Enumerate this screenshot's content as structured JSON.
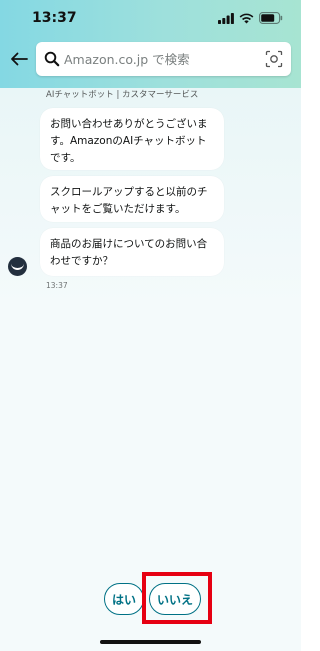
{
  "status_bar": {
    "time": "13:37",
    "icons": [
      "signal-icon",
      "wifi-icon",
      "battery-icon"
    ]
  },
  "header": {
    "back_icon": "back-arrow-icon",
    "search": {
      "placeholder": "Amazon.co.jp で検索",
      "value": ""
    },
    "camera_icon": "camera-icon"
  },
  "chat": {
    "title": "AIチャットボット | カスタマーサービス",
    "messages": [
      "お問い合わせありがとうございます。AmazonのAIチャットボットです。",
      "スクロールアップすると以前のチャットをご覧いただけます。",
      "商品のお届けについてのお問い合わせですか？"
    ],
    "timestamp": "13:37"
  },
  "quick_replies": {
    "yes_label": "はい",
    "no_label": "いいえ"
  },
  "colors": {
    "accent": "#007185",
    "highlight": "#e60012",
    "header_gradient_start": "#84d8e3",
    "header_gradient_end": "#a7e4d2"
  }
}
